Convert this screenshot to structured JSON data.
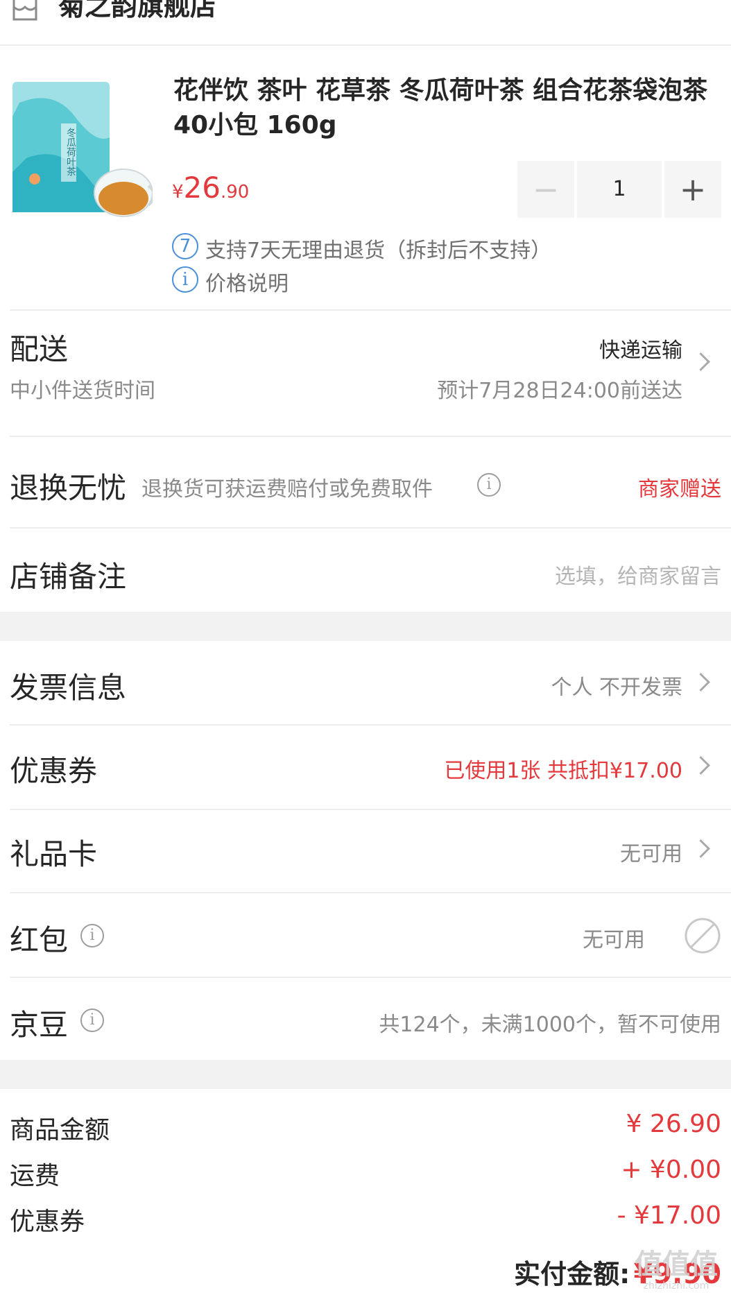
{
  "shop": {
    "icon": "shop-icon",
    "name": "菊之韵旗舰店"
  },
  "product": {
    "title": "花伴饮 茶叶 花草茶 冬瓜荷叶茶 组合花茶袋泡茶 40小包 160g",
    "package_text": "冬瓜荷叶茶",
    "price_symbol": "¥",
    "price_int": "26",
    "price_dec": ".90",
    "quantity": "1",
    "minus": "−",
    "plus": "+",
    "return_badge": "7",
    "return_policy": "支持7天无理由退货（拆封后不支持）",
    "info_icon": "i",
    "price_note": "价格说明"
  },
  "delivery": {
    "label": "配送",
    "sub_label": "中小件送货时间",
    "method": "快递运输",
    "eta": "预计7月28日24:00前送达"
  },
  "returns": {
    "label": "退换无忧",
    "desc": "退换货可获运费赔付或免费取件",
    "status": "商家赠送"
  },
  "note": {
    "label": "店铺备注",
    "placeholder": "选填，给商家留言"
  },
  "invoice": {
    "label": "发票信息",
    "value": "个人 不开发票"
  },
  "coupon": {
    "label": "优惠券",
    "value": "已使用1张 共抵扣¥17.00"
  },
  "giftcard": {
    "label": "礼品卡",
    "value": "无可用"
  },
  "redpacket": {
    "label": "红包",
    "value": "无可用"
  },
  "jingdou": {
    "label": "京豆",
    "value": "共124个，未满1000个，暂不可使用"
  },
  "summary": {
    "items": [
      {
        "label": "商品金额",
        "value": "¥ 26.90"
      },
      {
        "label": "运费",
        "value": "+ ¥0.00"
      },
      {
        "label": "优惠券",
        "value": "- ¥17.00"
      }
    ],
    "total_label": "实付金额:",
    "total_value": "¥9.90"
  },
  "watermark": {
    "text": "值值值",
    "url": "zhizhizhi.com"
  },
  "colors": {
    "accent_red": "#e4393c",
    "info_blue": "#4a90d9"
  }
}
